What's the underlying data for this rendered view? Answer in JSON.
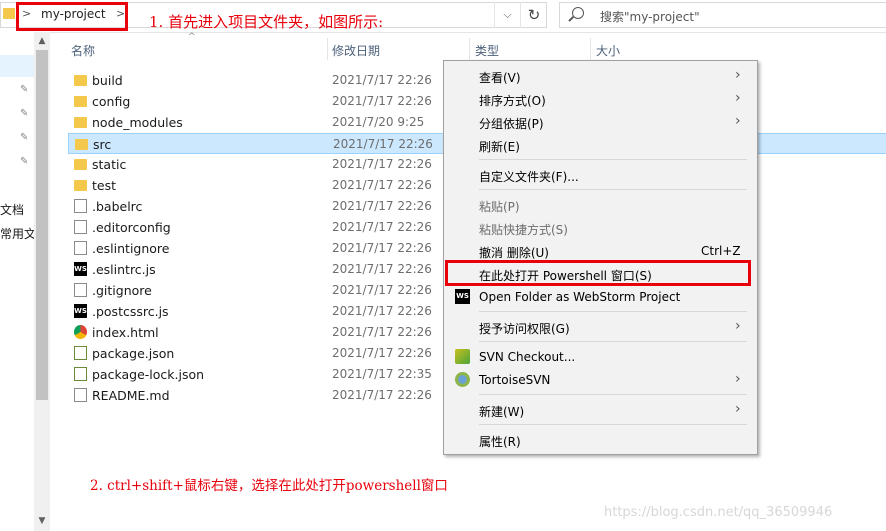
{
  "address": {
    "separator": ">",
    "crumb": "my-project",
    "search_placeholder": "搜索\"my-project\""
  },
  "annotations": {
    "step1": "1. 首先进入项目文件夹，如图所示:",
    "step2": "2. ctrl+shift+鼠标右键，选择在此处打开powershell窗口"
  },
  "nav": {
    "item1": "文档",
    "item2": "常用文档"
  },
  "columns": {
    "name": "名称",
    "date": "修改日期",
    "type": "类型",
    "size": "大小"
  },
  "files": [
    {
      "name": "build",
      "date": "2021/7/17 22:26",
      "icon": "folder-icon"
    },
    {
      "name": "config",
      "date": "2021/7/17 22:26",
      "icon": "folder-icon"
    },
    {
      "name": "node_modules",
      "date": "2021/7/20 9:25",
      "icon": "folder-icon"
    },
    {
      "name": "src",
      "date": "2021/7/17 22:26",
      "icon": "folder-icon",
      "selected": true
    },
    {
      "name": "static",
      "date": "2021/7/17 22:26",
      "icon": "folder-icon"
    },
    {
      "name": "test",
      "date": "2021/7/17 22:26",
      "icon": "folder-icon"
    },
    {
      "name": ".babelrc",
      "date": "2021/7/17 22:26",
      "icon": "file-icon"
    },
    {
      "name": ".editorconfig",
      "date": "2021/7/17 22:26",
      "icon": "file-icon"
    },
    {
      "name": ".eslintignore",
      "date": "2021/7/17 22:26",
      "icon": "file-icon"
    },
    {
      "name": ".eslintrc.js",
      "date": "2021/7/17 22:26",
      "icon": "webstorm-icon"
    },
    {
      "name": ".gitignore",
      "date": "2021/7/17 22:26",
      "icon": "file-icon"
    },
    {
      "name": ".postcssrc.js",
      "date": "2021/7/17 22:26",
      "icon": "webstorm-icon"
    },
    {
      "name": "index.html",
      "date": "2021/7/17 22:26",
      "icon": "chrome-icon"
    },
    {
      "name": "package.json",
      "date": "2021/7/17 22:26",
      "icon": "json-icon"
    },
    {
      "name": "package-lock.json",
      "date": "2021/7/17 22:35",
      "icon": "json-icon"
    },
    {
      "name": "README.md",
      "date": "2021/7/17 22:26",
      "icon": "file-icon"
    }
  ],
  "menu": {
    "view": "查看(V)",
    "sort": "排序方式(O)",
    "group": "分组依据(P)",
    "refresh": "刷新(E)",
    "customize": "自定义文件夹(F)...",
    "paste": "粘贴(P)",
    "paste_shortcut": "粘贴快捷方式(S)",
    "undo": "撤消 删除(U)",
    "undo_shortcut": "Ctrl+Z",
    "powershell": "在此处打开 Powershell 窗口(S)",
    "webstorm": "Open Folder as WebStorm Project",
    "access": "授予访问权限(G)",
    "svn_checkout": "SVN Checkout...",
    "tortoise": "TortoiseSVN",
    "new": "新建(W)",
    "properties": "属性(R)"
  },
  "watermark": "https://blog.csdn.net/qq_36509946",
  "colors": {
    "annotation_red": "#e8000b",
    "selection": "#cce8ff",
    "folder": "#f3c84b"
  }
}
